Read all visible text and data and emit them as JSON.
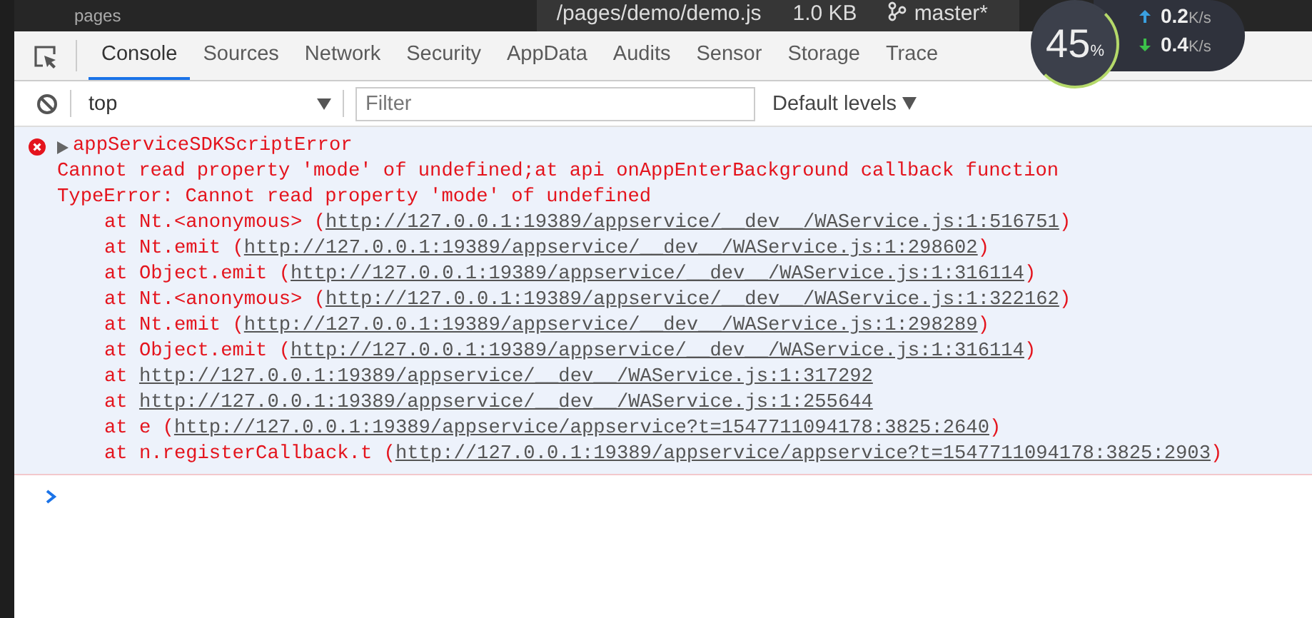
{
  "top_bar": {
    "folder": "pages",
    "file_path": "/pages/demo/demo.js",
    "file_size": "1.0 KB",
    "branch": "master*"
  },
  "monitor": {
    "percent": "45",
    "percent_unit": "%",
    "upload": "0.2",
    "upload_unit": "K/s",
    "download": "0.4",
    "download_unit": "K/s"
  },
  "tabs": [
    {
      "label": "Console",
      "selected": true
    },
    {
      "label": "Sources",
      "selected": false
    },
    {
      "label": "Network",
      "selected": false
    },
    {
      "label": "Security",
      "selected": false
    },
    {
      "label": "AppData",
      "selected": false
    },
    {
      "label": "Audits",
      "selected": false
    },
    {
      "label": "Sensor",
      "selected": false
    },
    {
      "label": "Storage",
      "selected": false
    },
    {
      "label": "Trace",
      "selected": false
    }
  ],
  "filter_bar": {
    "context": "top",
    "filter_placeholder": "Filter",
    "levels": "Default levels"
  },
  "error": {
    "title": "appServiceSDKScriptError",
    "expanded": false,
    "message": "Cannot read property 'mode' of undefined;at api onAppEnterBackground callback function",
    "type_line": "TypeError: Cannot read property 'mode' of undefined",
    "frames": [
      {
        "before": "at Nt.<anonymous> (",
        "link": "http://127.0.0.1:19389/appservice/__dev__/WAService.js:1:516751",
        "after": ")"
      },
      {
        "before": "at Nt.emit (",
        "link": "http://127.0.0.1:19389/appservice/__dev__/WAService.js:1:298602",
        "after": ")"
      },
      {
        "before": "at Object.emit (",
        "link": "http://127.0.0.1:19389/appservice/__dev__/WAService.js:1:316114",
        "after": ")"
      },
      {
        "before": "at Nt.<anonymous> (",
        "link": "http://127.0.0.1:19389/appservice/__dev__/WAService.js:1:322162",
        "after": ")"
      },
      {
        "before": "at Nt.emit (",
        "link": "http://127.0.0.1:19389/appservice/__dev__/WAService.js:1:298289",
        "after": ")"
      },
      {
        "before": "at Object.emit (",
        "link": "http://127.0.0.1:19389/appservice/__dev__/WAService.js:1:316114",
        "after": ")"
      },
      {
        "before": "at ",
        "link": "http://127.0.0.1:19389/appservice/__dev__/WAService.js:1:317292"
      },
      {
        "before": "at ",
        "link": "http://127.0.0.1:19389/appservice/__dev__/WAService.js:1:255644"
      },
      {
        "before": "at e (",
        "link": "http://127.0.0.1:19389/appservice/appservice?t=1547711094178:3825:2640",
        "after": ")"
      },
      {
        "before": "at n.registerCallback.t (",
        "link": "http://127.0.0.1:19389/appservice/appservice?t=1547711094178:3825:2903",
        "after": ")"
      }
    ]
  }
}
